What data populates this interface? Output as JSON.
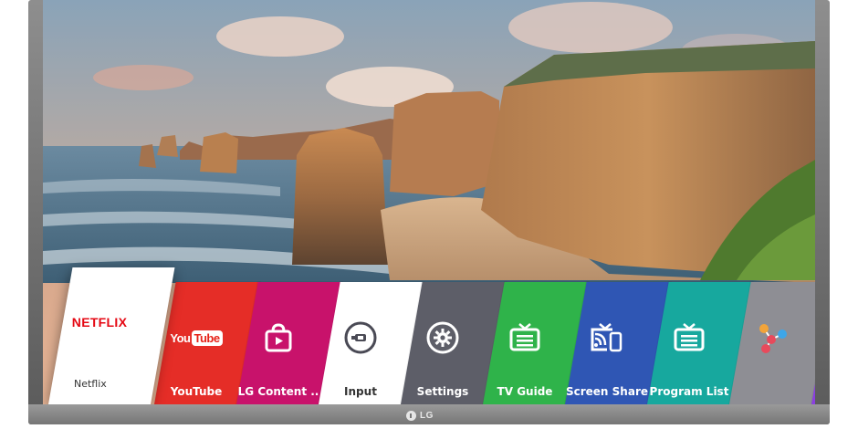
{
  "brand": {
    "logo_text": "LG"
  },
  "launcher": {
    "featured": {
      "name": "NETFLIX",
      "label": "Netflix"
    },
    "tiles": [
      {
        "label": "YouTube",
        "color": "#e52d27",
        "icon": "youtube-logo"
      },
      {
        "label": "LG Content ..",
        "color": "#c8126b",
        "icon": "lg-content-store-icon"
      },
      {
        "label": "Input",
        "color": "#ffffff",
        "icon": "input-icon"
      },
      {
        "label": "Settings",
        "color": "#5d5e68",
        "icon": "gear-icon"
      },
      {
        "label": "TV Guide",
        "color": "#2fb34a",
        "icon": "tv-guide-icon"
      },
      {
        "label": "Screen Share",
        "color": "#2f56b4",
        "icon": "screen-share-icon"
      },
      {
        "label": "Program List",
        "color": "#17a89e",
        "icon": "program-list-icon"
      },
      {
        "label": "",
        "color": "#8e8e94",
        "icon": "molecule-icon"
      }
    ],
    "yt_you": "You",
    "yt_tube": "Tube"
  },
  "colors": {
    "netflix_red": "#e50914",
    "accent_purple": "#8b3fe0"
  }
}
